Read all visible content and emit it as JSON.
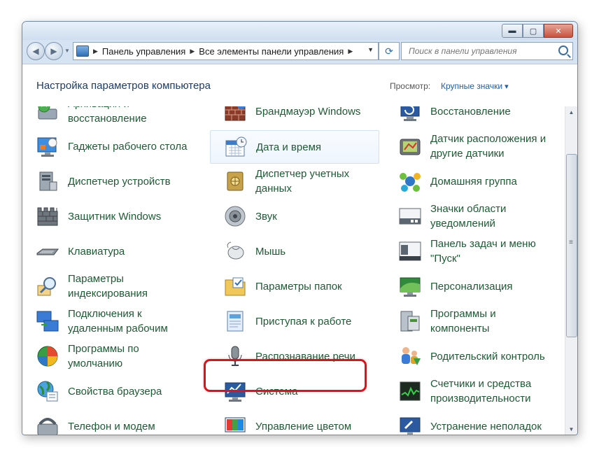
{
  "window": {
    "buttons": {
      "minimize": "▬",
      "maximize": "▢",
      "close": "✕"
    }
  },
  "nav": {
    "back": "◀",
    "forward": "▶",
    "breadcrumb": [
      "Панель управления",
      "Все элементы панели управления"
    ],
    "search_placeholder": "Поиск в панели управления"
  },
  "header": {
    "title": "Настройка параметров компьютера",
    "view_by": "Просмотр:",
    "view_mode": "Крупные значки"
  },
  "items": [
    {
      "label": "Архивация и восстановление",
      "icon": "backup-icon"
    },
    {
      "label": "Брандмауэр Windows",
      "icon": "firewall-icon"
    },
    {
      "label": "Восстановление",
      "icon": "recovery-icon"
    },
    {
      "label": "Гаджеты рабочего стола",
      "icon": "gadgets-icon"
    },
    {
      "label": "Дата и время",
      "icon": "calendar-clock-icon"
    },
    {
      "label": "Датчик расположения и другие датчики",
      "icon": "location-sensor-icon"
    },
    {
      "label": "Диспетчер устройств",
      "icon": "device-manager-icon"
    },
    {
      "label": "Диспетчер учетных данных",
      "icon": "credential-vault-icon"
    },
    {
      "label": "Домашняя группа",
      "icon": "homegroup-icon"
    },
    {
      "label": "Защитник Windows",
      "icon": "defender-icon"
    },
    {
      "label": "Звук",
      "icon": "speaker-icon"
    },
    {
      "label": "Значки области уведомлений",
      "icon": "notification-area-icon"
    },
    {
      "label": "Клавиатура",
      "icon": "keyboard-icon"
    },
    {
      "label": "Мышь",
      "icon": "mouse-icon"
    },
    {
      "label": "Панель задач и меню \"Пуск\"",
      "icon": "taskbar-icon"
    },
    {
      "label": "Параметры индексирования",
      "icon": "indexing-icon"
    },
    {
      "label": "Параметры папок",
      "icon": "folder-options-icon"
    },
    {
      "label": "Персонализация",
      "icon": "personalization-icon"
    },
    {
      "label": "Подключения к удаленным рабочим",
      "icon": "remote-desktop-icon"
    },
    {
      "label": "Приступая к работе",
      "icon": "getting-started-icon"
    },
    {
      "label": "Программы и компоненты",
      "icon": "programs-features-icon"
    },
    {
      "label": "Программы по умолчанию",
      "icon": "default-programs-icon"
    },
    {
      "label": "Распознавание речи",
      "icon": "microphone-icon"
    },
    {
      "label": "Родительский контроль",
      "icon": "parental-control-icon"
    },
    {
      "label": "Свойства браузера",
      "icon": "browser-globe-icon"
    },
    {
      "label": "Система",
      "icon": "system-monitor-icon"
    },
    {
      "label": "Счетчики и средства производительности",
      "icon": "performance-icon"
    },
    {
      "label": "Телефон и модем",
      "icon": "phone-modem-icon"
    },
    {
      "label": "Управление цветом",
      "icon": "color-management-icon"
    },
    {
      "label": "Устранение неполадок",
      "icon": "troubleshooting-icon"
    }
  ]
}
